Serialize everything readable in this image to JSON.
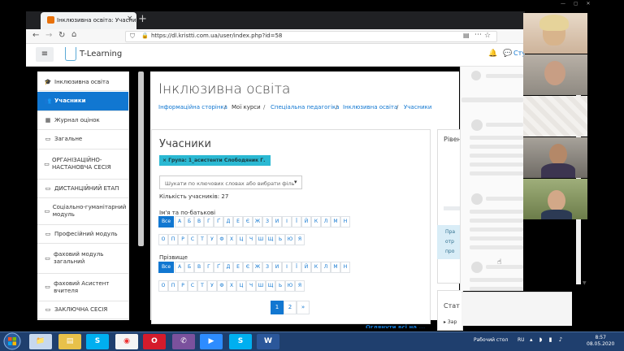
{
  "browser": {
    "tab_title": "Інклюзивна освіта: Учасники",
    "url": "https://dl.kristti.com.ua/user/index.php?id=58",
    "new_tab_symbol": "+",
    "tab_close_symbol": "×"
  },
  "header": {
    "brand": "T-Learning",
    "user_link": "Сту"
  },
  "sidebar": {
    "items": [
      {
        "label": "Інклюзивна освіта",
        "icon": "graduation-cap-icon",
        "icon_glyph": "🎓"
      },
      {
        "label": "Учасники",
        "icon": "users-icon",
        "icon_glyph": "👥",
        "active": true
      },
      {
        "label": "Журнал оцінок",
        "icon": "table-icon",
        "icon_glyph": "▦"
      },
      {
        "label": "Загальне",
        "icon": "folder-icon",
        "icon_glyph": "▭"
      },
      {
        "label": "ОРГАНІЗАЦІЙНО-НАСТАНОВЧА СЕСІЯ",
        "icon": "folder-icon",
        "icon_glyph": "▭"
      },
      {
        "label": "ДИСТАНЦІЙНИЙ ЕТАП",
        "icon": "folder-icon",
        "icon_glyph": "▭"
      },
      {
        "label": "Соціально-гуманітарний модуль",
        "icon": "folder-icon",
        "icon_glyph": "▭"
      },
      {
        "label": "Професійний модуль",
        "icon": "folder-icon",
        "icon_glyph": "▭"
      },
      {
        "label": "фаховий модуль загальний",
        "icon": "folder-icon",
        "icon_glyph": "▭"
      },
      {
        "label": "фаховий Асистент вчителя",
        "icon": "folder-icon",
        "icon_glyph": "▭"
      },
      {
        "label": "ЗАКЛЮЧНА СЕСІЯ",
        "icon": "folder-icon",
        "icon_glyph": "▭"
      }
    ]
  },
  "main": {
    "page_title": "Інклюзивна освіта",
    "breadcrumb": [
      "Інформаційна сторінка",
      "Мої курси",
      "Спеціальна педагогіка",
      "Інклюзивна освіта",
      "Учасники"
    ],
    "card_title": "Учасники",
    "filter_pill": "× Група: 1_асистенти Слободяник Г.",
    "search_placeholder": "Шукати по ключових словах або вибрати філь",
    "participants_count": "Кількість учасників: 27",
    "firstname_label": "Ім'я та по-батькові",
    "lastname_label": "Прізвище",
    "all_label": "Все",
    "letters_row1": [
      "А",
      "Б",
      "В",
      "Г",
      "Ґ",
      "Д",
      "Е",
      "Є",
      "Ж",
      "З",
      "И",
      "І",
      "Ї",
      "Й",
      "К",
      "Л",
      "М",
      "Н"
    ],
    "letters_row2": [
      "О",
      "П",
      "Р",
      "С",
      "Т",
      "У",
      "Ф",
      "Х",
      "Ц",
      "Ч",
      "Ш",
      "Щ",
      "Ь",
      "Ю",
      "Я"
    ],
    "pagination": [
      "1",
      "2",
      "»"
    ],
    "show_all": "Оглянути всі на ..."
  },
  "right_blocks": {
    "block1_title": "Рівен",
    "info_text": "Пра\nотр\nпро",
    "block2_title": "Стат",
    "block2_sub": "▸ Зар"
  },
  "taskbar": {
    "apps": [
      "explorer",
      "file-manager",
      "skype",
      "chrome",
      "opera",
      "viber",
      "zoom",
      "skype",
      "word"
    ],
    "desktop_label": "Рабочий стол",
    "lang": "RU",
    "time": "8:57",
    "date": "08.05.2020"
  }
}
